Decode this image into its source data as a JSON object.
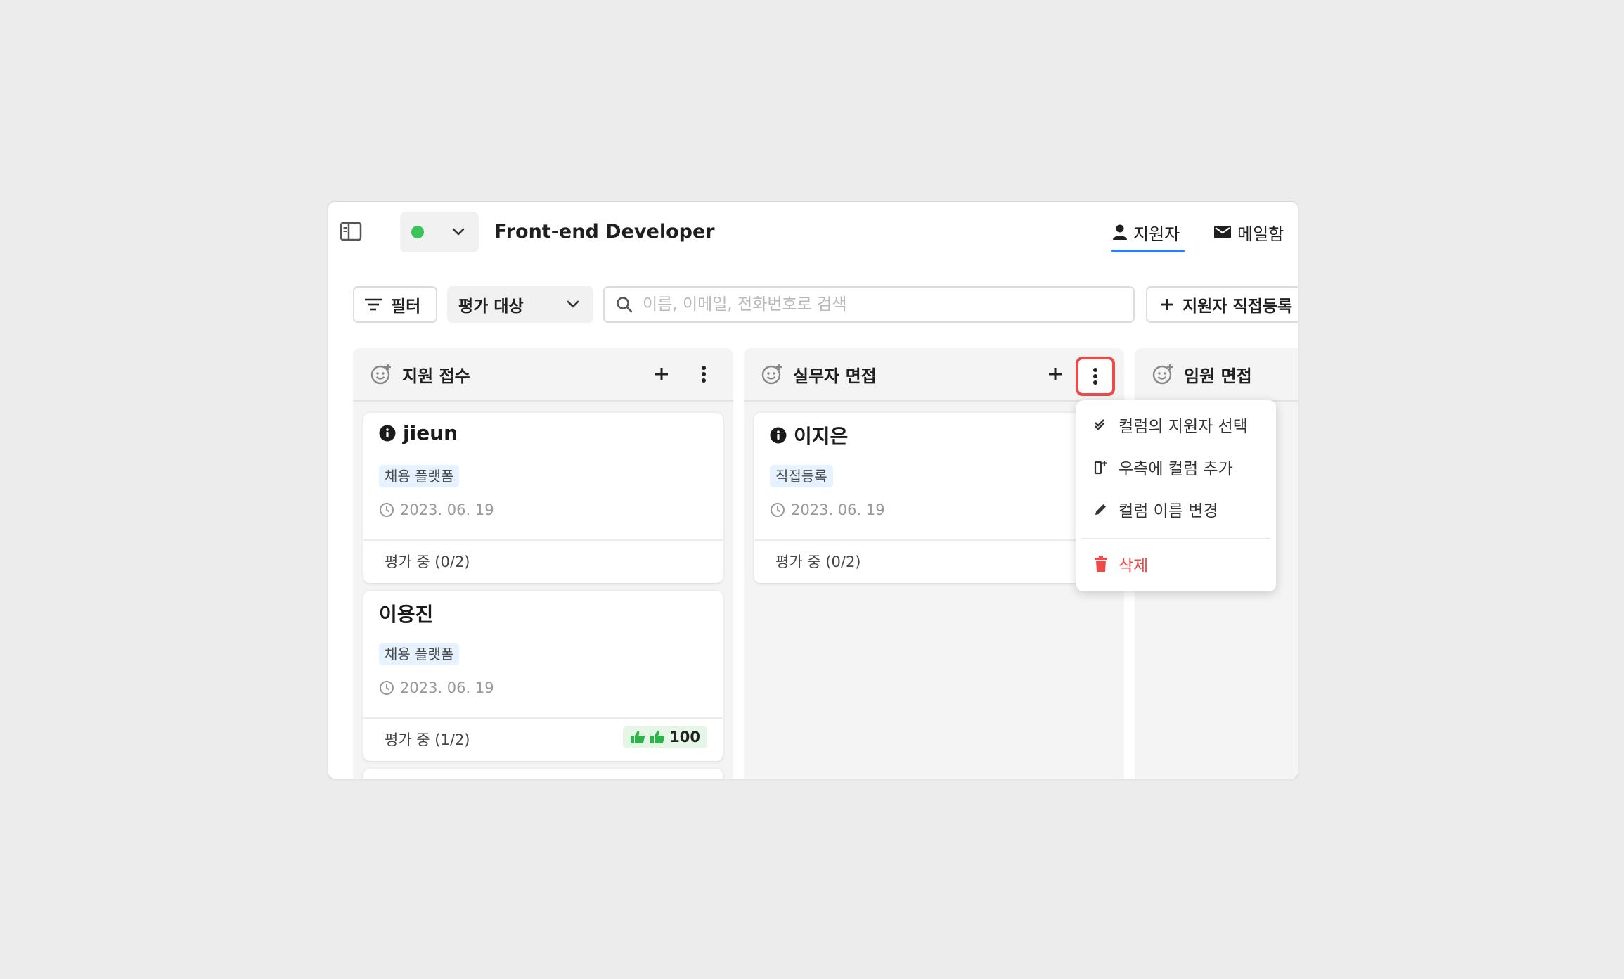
{
  "header": {
    "title": "Front-end Developer",
    "tabs": [
      {
        "label": "지원자",
        "icon": "person-icon",
        "active": true
      },
      {
        "label": "메일함",
        "icon": "mail-icon",
        "active": false
      }
    ],
    "status_color": "#3cc45a",
    "accent_color": "#2f7df6"
  },
  "toolbar": {
    "filter_label": "필터",
    "select_value": "평가 대상",
    "search_placeholder": "이름, 이메일, 전화번호로 검색",
    "register_label": "지원자 직접등록"
  },
  "columns": [
    {
      "title": "지원 접수",
      "cards": [
        {
          "name": "jieun",
          "has_info_icon": true,
          "tag": "채용 플랫폼",
          "date": "2023. 06. 19",
          "status": "평가 중 (0/2)"
        },
        {
          "name": "이용진",
          "has_info_icon": false,
          "tag": "채용 플랫폼",
          "date": "2023. 06. 19",
          "status": "평가 중 (1/2)",
          "score": "100"
        }
      ]
    },
    {
      "title": "실무자 면접",
      "cards": [
        {
          "name": "이지은",
          "has_info_icon": true,
          "tag": "직접등록",
          "date": "2023. 06. 19",
          "status": "평가 중 (0/2)"
        }
      ]
    },
    {
      "title": "임원 면접",
      "cards": []
    }
  ],
  "context_menu": {
    "items": [
      {
        "label": "컬럼의 지원자 선택",
        "icon": "double-check-icon"
      },
      {
        "label": "우측에 컬럼 추가",
        "icon": "add-column-icon"
      },
      {
        "label": "컬럼 이름 변경",
        "icon": "pencil-icon"
      }
    ],
    "delete_label": "삭제",
    "delete_color": "#ee4a4a"
  }
}
